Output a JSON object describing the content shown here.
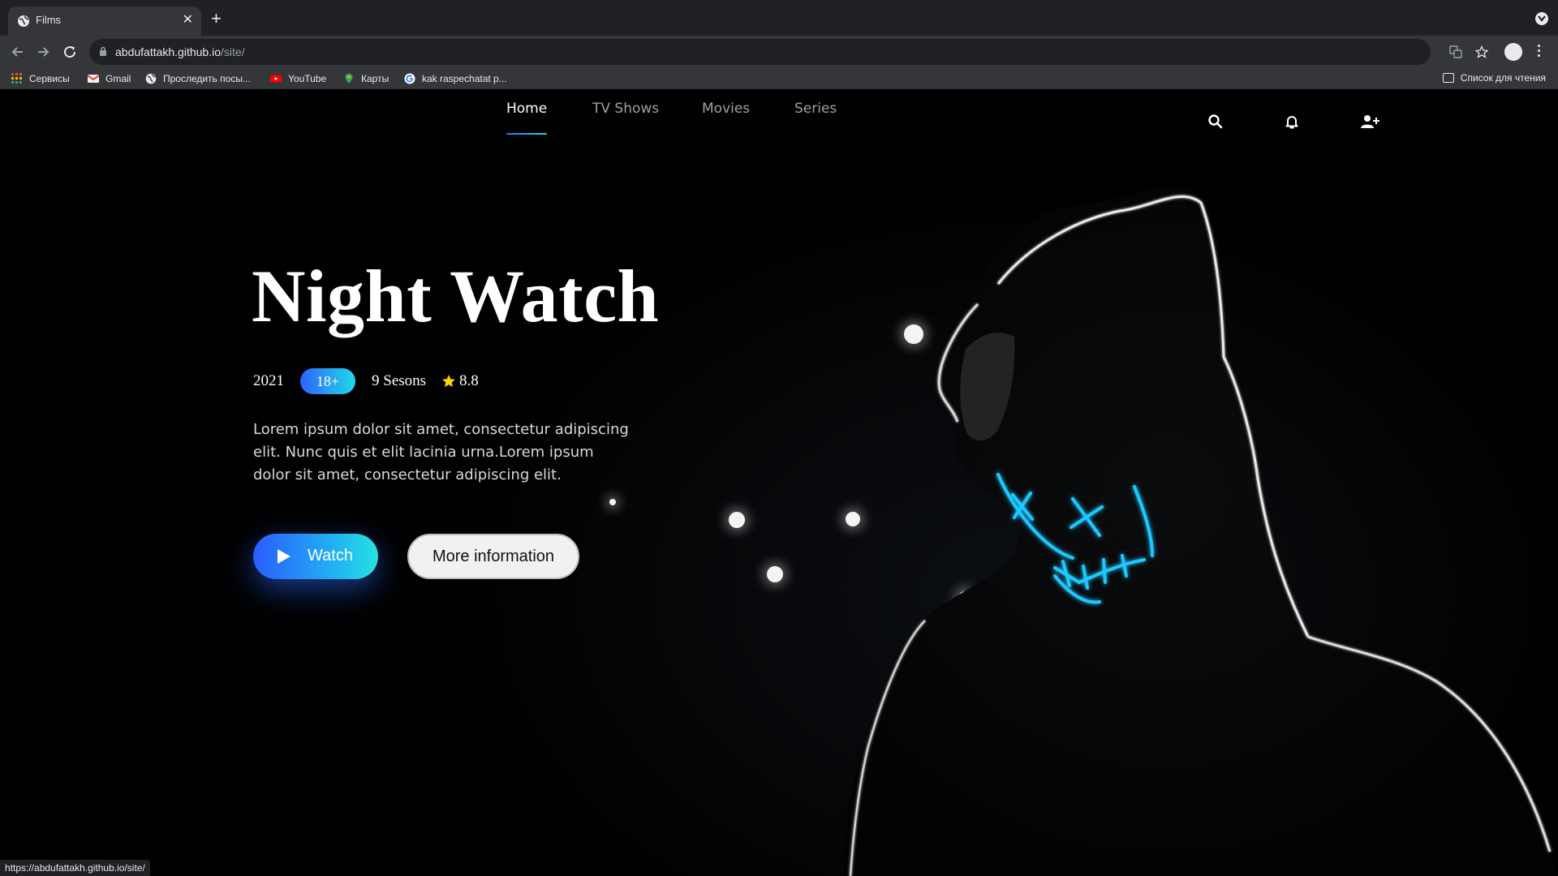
{
  "browser": {
    "tab_title": "Films",
    "url_host": "abdufattakh.github.io",
    "url_path": "/site/",
    "status_url": "https://abdufattakh.github.io/site/",
    "bookmarks": [
      {
        "label": "Сервисы",
        "icon": "apps-grid-icon",
        "color": "#ea4335"
      },
      {
        "label": "Gmail",
        "icon": "gmail-icon",
        "color": "#ea4335"
      },
      {
        "label": "Проследить посы...",
        "icon": "globe-icon",
        "color": "#e8eaed"
      },
      {
        "label": "YouTube",
        "icon": "youtube-icon",
        "color": "#ff0000"
      },
      {
        "label": "Карты",
        "icon": "maps-pin-icon",
        "color": "#34a853"
      },
      {
        "label": "kak raspechatat p...",
        "icon": "google-icon",
        "color": "#4285f4"
      }
    ],
    "reading_list": "Список для чтения"
  },
  "site": {
    "nav": [
      "Home",
      "TV Shows",
      "Movies",
      "Series"
    ],
    "active_nav": "Home",
    "icons": [
      "search-icon",
      "bell-icon",
      "add-user-icon"
    ]
  },
  "hero": {
    "title": "Night Watch",
    "year": "2021",
    "age_rating": "18+",
    "seasons": "9 Sesons",
    "score": "8.8",
    "description": "Lorem ipsum dolor sit amet, consectetur adipiscing elit. Nunc quis et elit lacinia urna.Lorem ipsum dolor sit amet, consectetur adipiscing elit.",
    "watch_label": "Watch",
    "more_label": "More information"
  },
  "colors": {
    "accent_start": "#2b5cff",
    "accent_end": "#27e2e0",
    "mask_neon": "#1ec8ff"
  }
}
